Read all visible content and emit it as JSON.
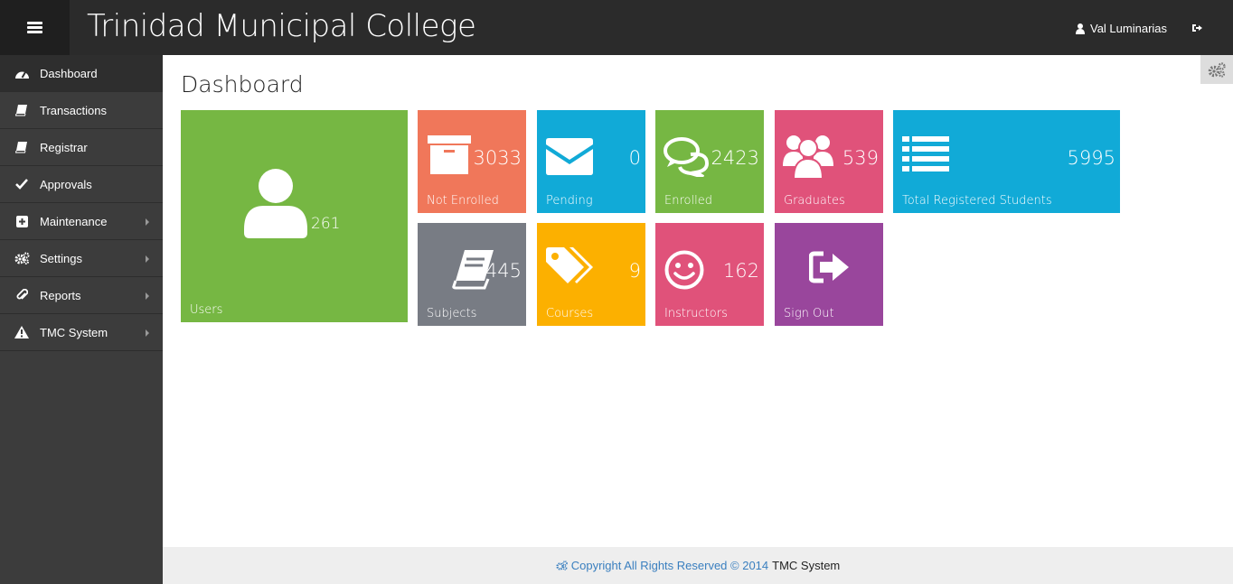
{
  "header": {
    "title": "Trinidad Municipal College",
    "user_name": "Val Luminarias"
  },
  "sidebar": {
    "items": [
      {
        "label": "Dashboard",
        "icon": "dashboard-icon"
      },
      {
        "label": "Transactions",
        "icon": "book-icon"
      },
      {
        "label": "Registrar",
        "icon": "book-icon"
      },
      {
        "label": "Approvals",
        "icon": "check-icon"
      },
      {
        "label": "Maintenance",
        "icon": "plus-square-icon"
      },
      {
        "label": "Settings",
        "icon": "gears-icon"
      },
      {
        "label": "Reports",
        "icon": "paperclip-icon"
      },
      {
        "label": "TMC System",
        "icon": "warning-icon"
      }
    ]
  },
  "main": {
    "title": "Dashboard"
  },
  "tiles": {
    "users": {
      "label": "Users",
      "count": "261",
      "color": "#76b743"
    },
    "not_enrolled": {
      "label": "Not Enrolled",
      "count": "3033",
      "color": "#f0775a"
    },
    "pending": {
      "label": "Pending",
      "count": "0",
      "color": "#11aad7"
    },
    "enrolled": {
      "label": "Enrolled",
      "count": "2423",
      "color": "#76b743"
    },
    "graduates": {
      "label": "Graduates",
      "count": "539",
      "color": "#e0527a"
    },
    "total_registered": {
      "label": "Total Registered Students",
      "count": "5995",
      "color": "#11aad7"
    },
    "subjects": {
      "label": "Subjects",
      "count": "445",
      "color": "#787c84"
    },
    "courses": {
      "label": "Courses",
      "count": "9",
      "color": "#fcb000"
    },
    "instructors": {
      "label": "Instructors",
      "count": "162",
      "color": "#e0527a"
    },
    "signout": {
      "label": "Sign Out",
      "color": "#99469c"
    }
  },
  "footer": {
    "copyright": "Copyright All Rights Reserved © 2014",
    "system": "TMC System"
  }
}
